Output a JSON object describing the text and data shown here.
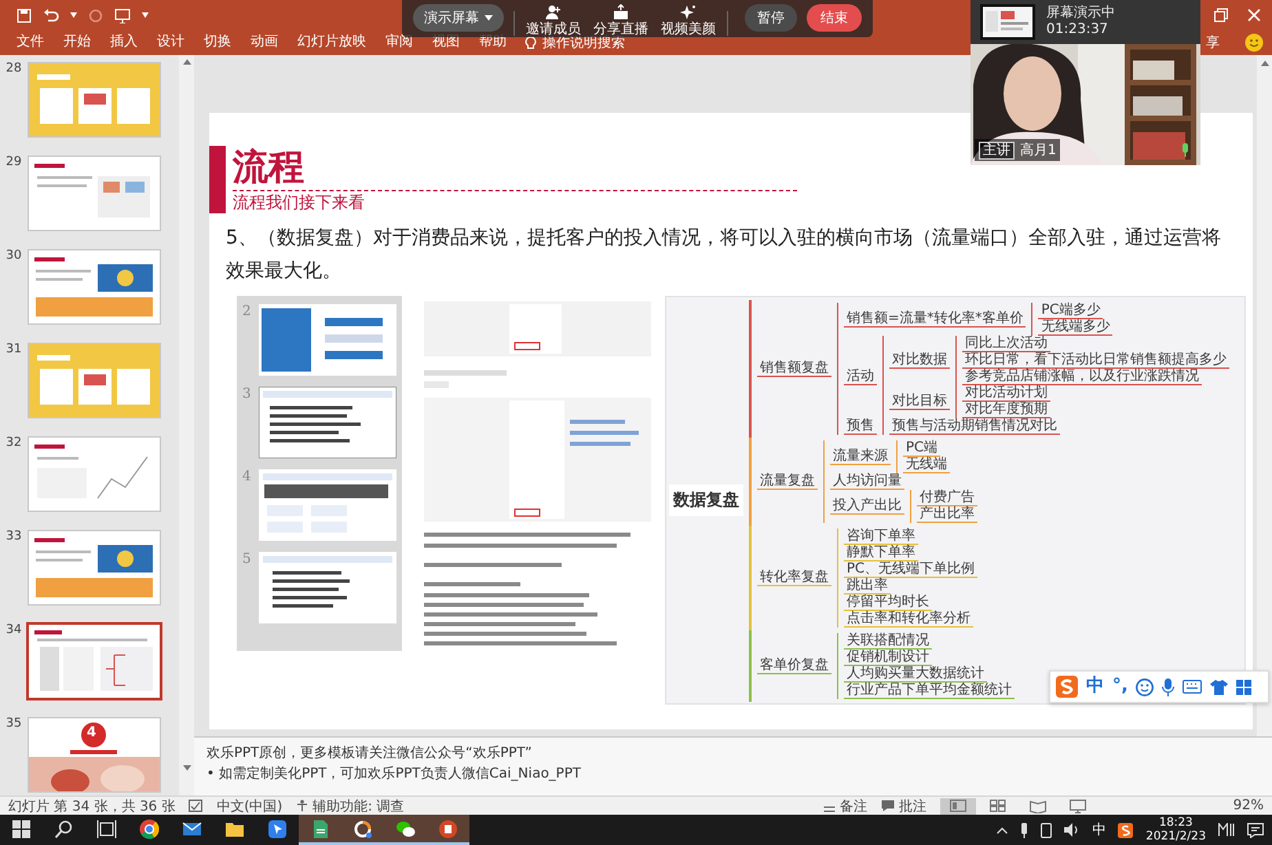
{
  "ribbon": {
    "tabs": [
      {
        "label": "文件",
        "selected": false
      },
      {
        "label": "开始",
        "selected": false
      },
      {
        "label": "插入",
        "selected": false
      },
      {
        "label": "设计",
        "selected": false
      },
      {
        "label": "切换",
        "selected": false
      },
      {
        "label": "动画",
        "selected": false
      },
      {
        "label": "幻灯片放映",
        "selected": false
      },
      {
        "label": "审阅",
        "selected": false
      },
      {
        "label": "视图",
        "selected": false
      },
      {
        "label": "帮助",
        "selected": false
      }
    ],
    "search": "操作说明搜索",
    "share_label": "享"
  },
  "share_bar": {
    "source": "演示屏幕",
    "actions": [
      {
        "kind": "invite",
        "label": "邀请成员"
      },
      {
        "kind": "live",
        "label": "分享直播"
      },
      {
        "kind": "beauty",
        "label": "视频美颜"
      }
    ],
    "pause": "暂停",
    "end": "结束"
  },
  "camera": {
    "status": "屏幕演示中",
    "elapsed": "01:23:37",
    "role": "主讲",
    "name": "高月1"
  },
  "slides_panel": {
    "slides": [
      {
        "number": "28",
        "kind": "yellow",
        "selected": false
      },
      {
        "number": "29",
        "kind": "list",
        "selected": false
      },
      {
        "number": "30",
        "kind": "banner",
        "selected": false
      },
      {
        "number": "31",
        "kind": "yellow",
        "selected": false
      },
      {
        "number": "32",
        "kind": "chart",
        "selected": false
      },
      {
        "number": "33",
        "kind": "banner",
        "selected": false
      },
      {
        "number": "34",
        "kind": "mindmap",
        "selected": true
      },
      {
        "number": "35",
        "kind": "cover",
        "selected": false,
        "badge": "4"
      }
    ]
  },
  "slide": {
    "title": "流程",
    "subtitle": "流程我们接下来看",
    "paragraph": "5、（数据复盘）对于消费品来说，提托客户的投入情况，将可以入驻的横向市场（流量端口）全部入驻，通过运营将效果最大化。",
    "embedded_slide_numbers": [
      "2",
      "3",
      "4",
      "5"
    ],
    "mind_map": {
      "root": "数据复盘",
      "branches": [
        {
          "label": "销售额复盘",
          "color": "#d9534f",
          "children": [
            {
              "label": "销售额=流量*转化率*客单价",
              "children": [
                {
                  "label": "PC端多少"
                },
                {
                  "label": "无线端多少"
                }
              ]
            },
            {
              "label": "活动",
              "children": [
                {
                  "label": "对比数据",
                  "children": [
                    {
                      "label": "同比上次活动"
                    },
                    {
                      "label": "环比日常，看下活动比日常销售额提高多少"
                    },
                    {
                      "label": "参考竞品店铺涨幅，以及行业涨跌情况"
                    }
                  ]
                },
                {
                  "label": "对比目标",
                  "children": [
                    {
                      "label": "对比活动计划"
                    },
                    {
                      "label": "对比年度预期"
                    }
                  ]
                }
              ]
            },
            {
              "label": "预售",
              "children": [
                {
                  "label": "预售与活动期销售情况对比"
                }
              ]
            }
          ]
        },
        {
          "label": "流量复盘",
          "color": "#f0a040",
          "children": [
            {
              "label": "流量来源",
              "children": [
                {
                  "label": "PC端"
                },
                {
                  "label": "无线端"
                }
              ]
            },
            {
              "label": "人均访问量"
            },
            {
              "label": "投入产出比",
              "children": [
                {
                  "label": "付费广告"
                },
                {
                  "label": "产出比率"
                }
              ]
            }
          ]
        },
        {
          "label": "转化率复盘",
          "color": "#e3c13b",
          "children": [
            {
              "label": "咨询下单率"
            },
            {
              "label": "静默下单率"
            },
            {
              "label": "PC、无线端下单比例"
            },
            {
              "label": "跳出率"
            },
            {
              "label": "停留平均时长"
            },
            {
              "label": "点击率和转化率分析"
            }
          ]
        },
        {
          "label": "客单价复盘",
          "color": "#8cc04a",
          "children": [
            {
              "label": "关联搭配情况"
            },
            {
              "label": "促销机制设计"
            },
            {
              "label": "人均购买量大数据统计"
            },
            {
              "label": "行业产品下单平均金额统计"
            }
          ]
        }
      ]
    }
  },
  "notes": [
    "欢乐PPT原创，更多模板请关注微信公众号“欢乐PPT”",
    "• 如需定制美化PPT，可加欢乐PPT负责人微信Cai_Niao_PPT"
  ],
  "ime_toolbar": {
    "mode": "中",
    "punctuation": "°,"
  },
  "status_bar": {
    "slide_position": "幻灯片 第 34 张，共 36 张",
    "language": "中文(中国)",
    "accessibility": "辅助功能: 调查",
    "notes_button": "备注",
    "comments_button": "批注",
    "views": [
      {
        "kind": "normal",
        "selected": true
      },
      {
        "kind": "sorter",
        "selected": false
      },
      {
        "kind": "reading",
        "selected": false
      },
      {
        "kind": "show",
        "selected": false
      }
    ],
    "zoom": "92%"
  },
  "taskbar": {
    "apps": [
      {
        "kind": "start",
        "open": false
      },
      {
        "kind": "search",
        "open": false
      },
      {
        "kind": "task-view",
        "open": false
      },
      {
        "kind": "browser",
        "open": false
      },
      {
        "kind": "mail",
        "open": false
      },
      {
        "kind": "folder",
        "open": false
      },
      {
        "kind": "pointer",
        "open": false
      },
      {
        "kind": "pdf",
        "open": true
      },
      {
        "kind": "loop",
        "open": true
      },
      {
        "kind": "chat",
        "open": true
      },
      {
        "kind": "slides",
        "open": true
      }
    ],
    "ime": "中",
    "time": "18:23",
    "date": "2021/2/23"
  }
}
